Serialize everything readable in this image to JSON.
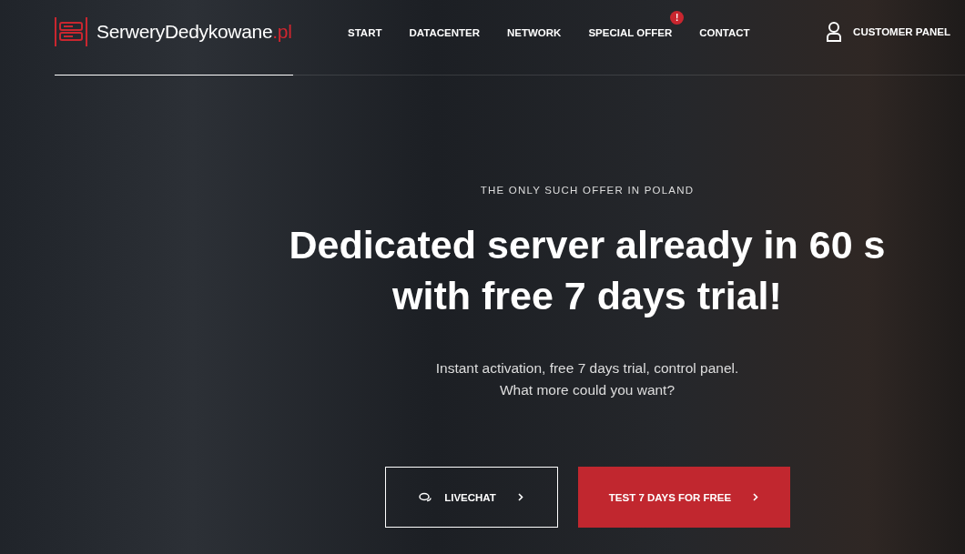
{
  "brand": {
    "name": "SerweryDedykowane",
    "suffix": ".pl"
  },
  "nav": [
    {
      "label": "START"
    },
    {
      "label": "DATACENTER"
    },
    {
      "label": "NETWORK"
    },
    {
      "label": "SPECIAL OFFER",
      "badge": "!"
    },
    {
      "label": "CONTACT"
    }
  ],
  "customer_panel": "CUSTOMER PANEL",
  "hero": {
    "tagline": "THE ONLY SUCH OFFER IN POLAND",
    "heading_lines": [
      "Dedicated server already in 60 s",
      "with free 7 days trial!"
    ],
    "subtitle_lines": [
      "Instant activation, free 7 days trial, control panel.",
      "What more could you want?"
    ]
  },
  "buttons": [
    {
      "kind": "outline",
      "label": "LIVECHAT"
    },
    {
      "kind": "primary",
      "label": "TEST 7 DAYS FOR FREE"
    }
  ]
}
